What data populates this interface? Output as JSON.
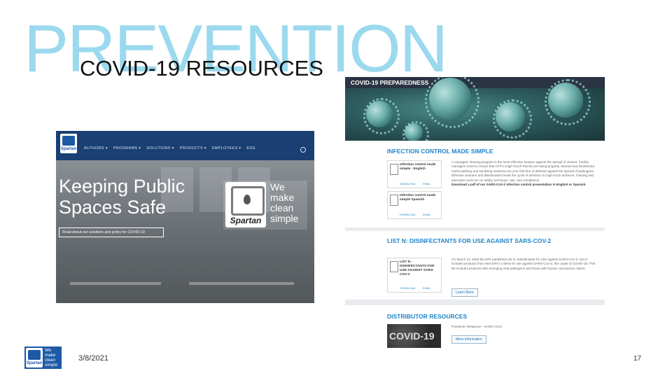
{
  "slide": {
    "background_word": "PREVENTION",
    "title": "COVID-19 RESOURCES",
    "date": "3/8/2021",
    "page_number": "17"
  },
  "left_screenshot": {
    "logo_text": "Spartan",
    "nav_items": [
      "AUTHORS ▾",
      "PROGRAMS ▾",
      "SOLUTIONS ▾",
      "PRODUCTS ▾",
      "EMPLOYEES ▾",
      "ESG"
    ],
    "headline": "Keeping Public Spaces Safe",
    "brand_wordmark": "Spartan",
    "brand_tagline": "We make clean simple",
    "cta_text": "Read about our solutions and policy for COVID-19"
  },
  "right_screenshot": {
    "banner_title": "COVID-19 PREPAREDNESS",
    "sections": {
      "infection": {
        "heading": "INFECTION CONTROL MADE SIMPLE",
        "docs": [
          {
            "title": "Infection control made simple - English",
            "download": "DOWNLOAD",
            "email": "EMAIL"
          },
          {
            "title": "Infection control made simple Spanish",
            "download": "DOWNLOAD",
            "email": "EMAIL"
          }
        ],
        "body": "A managed cleaning program is the most effective weapon against the spread of viruses. Facility managers need to ensure that HTT's (High Touch Points) are being properly cleaned and disinfected. Hand washing and sanitizing solutions are your first line of defense against the spread of pathogens. Effective cleaners and disinfectants break the cycle of infection on high touch surfaces. Training and education tools are on safety, technique, tips, and compliance.",
        "body_bold": "Download a pdf of our SARS-CoV-2 infection control presentation in English or Spanish"
      },
      "list_n": {
        "heading": "LIST N: DISINFECTANTS FOR USE AGAINST SARS-COV-2",
        "doc": {
          "title": "LIST N - DISINFECTANTS FOR USE AGAINST SARS-COV-2",
          "download": "DOWNLOAD",
          "email": "EMAIL"
        },
        "body": "On March 13, 2020 the EPA published List N: Disinfectants for Use Against SARS-CoV-2. List N includes products that meet EPA's criteria for use against SARS-CoV-2, the cause of COVID-19. This list includes products with emerging viral pathogens and those with human coronavirus claims.",
        "button": "Learn More"
      },
      "distributor": {
        "heading": "DISTRIBUTOR RESOURCES",
        "thumb_text": "COVID-19",
        "item_title": "Pandemic Response - SARS-CoV2",
        "button": "More Information"
      }
    }
  },
  "footer_logo": {
    "brand": "Spartan",
    "tagline": "We make clean simple"
  }
}
